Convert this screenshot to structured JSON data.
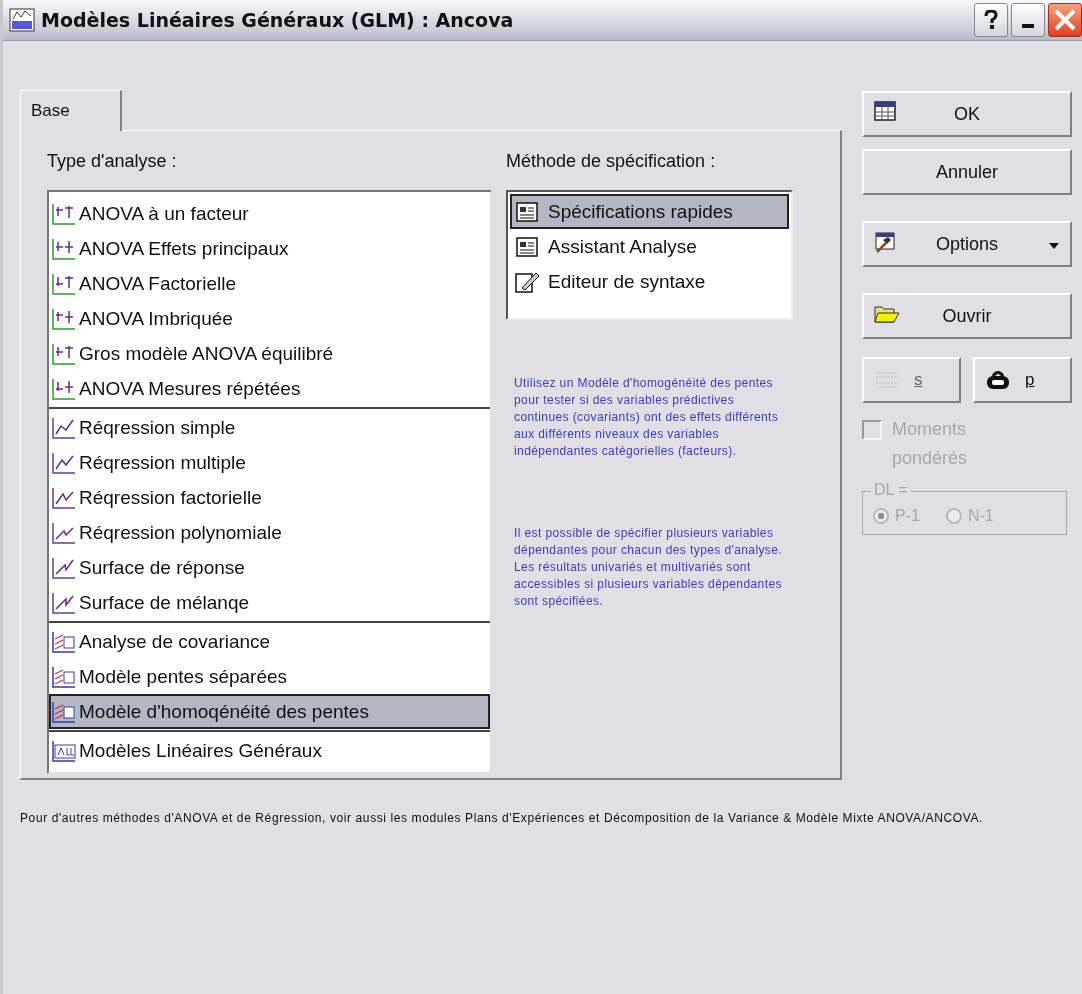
{
  "window": {
    "title": "Modèles Linéaires Généraux (GLM) : Ancova"
  },
  "tabs": [
    {
      "label": "Base",
      "selected": true
    }
  ],
  "analysis": {
    "label": "Type d'analyse :",
    "groups": [
      {
        "items": [
          {
            "label": "ANOVA à un facteur",
            "selected": false
          },
          {
            "label": "ANOVA Effets principaux",
            "selected": false
          },
          {
            "label": "ANOVA Factorielle",
            "selected": false
          },
          {
            "label": "ANOVA Imbriquée",
            "selected": false
          },
          {
            "label": "Gros modèle ANOVA équilibré",
            "selected": false
          },
          {
            "label": "ANOVA Mesures répétées",
            "selected": false
          }
        ]
      },
      {
        "items": [
          {
            "label": "Réqression simple",
            "selected": false
          },
          {
            "label": "Réqression multiple",
            "selected": false
          },
          {
            "label": "Réqression factorielle",
            "selected": false
          },
          {
            "label": "Réqression polynomiale",
            "selected": false
          },
          {
            "label": "Surface de réponse",
            "selected": false
          },
          {
            "label": "Surface de mélanqe",
            "selected": false
          }
        ]
      },
      {
        "items": [
          {
            "label": "Analyse de covariance",
            "selected": false
          },
          {
            "label": "Modèle pentes séparées",
            "selected": false
          },
          {
            "label": "Modèle d'homoqénéité des pentes",
            "selected": true
          }
        ]
      },
      {
        "items": [
          {
            "label": "Modèles Linéaires Généraux",
            "selected": false
          }
        ]
      }
    ]
  },
  "method": {
    "label": "Méthode de spécification :",
    "items": [
      {
        "label": "Spécifications rapides",
        "selected": true
      },
      {
        "label": "Assistant Analyse",
        "selected": false
      },
      {
        "label": "Editeur de syntaxe",
        "selected": false
      }
    ]
  },
  "info": [
    "Utilisez un Modèle d'homogénéité des pentes pour tester si des variables prédictives continues (covariants) ont des effets différents aux différents niveaux des variables indépendantes catégorielles (facteurs).",
    "Il est possible de spécifier plusieurs variables dépendantes pour chacun des types d'analyse.  Les résultats univariés et multivariés sont accessibles si plusieurs variables dépendantes sont spécifiées."
  ],
  "buttons": [
    {
      "label": "OK",
      "kind": "table"
    },
    {
      "label": "Annuler",
      "kind": "plain"
    },
    {
      "label": "Options",
      "kind": "menu"
    },
    {
      "label": "Ouvrir",
      "kind": "folder"
    }
  ],
  "small_buttons": [
    {
      "label": "s",
      "kind": "select",
      "disabled": true
    },
    {
      "label": "p",
      "kind": "weight",
      "disabled": false
    }
  ],
  "weighted": {
    "label_line1": "Moments",
    "label_line2": "pondérés",
    "checked": false,
    "disabled": true
  },
  "df": {
    "label": "DL =",
    "disabled": true,
    "options": [
      {
        "label": "P-1",
        "selected": true
      },
      {
        "label": "N-1",
        "selected": false
      }
    ]
  },
  "footer": "Pour d'autres méthodes d'ANOVA et de Régression, voir aussi les modules Plans d'Expériences et Décomposition de la Variance & Modèle Mixte ANOVA/ANCOVA."
}
